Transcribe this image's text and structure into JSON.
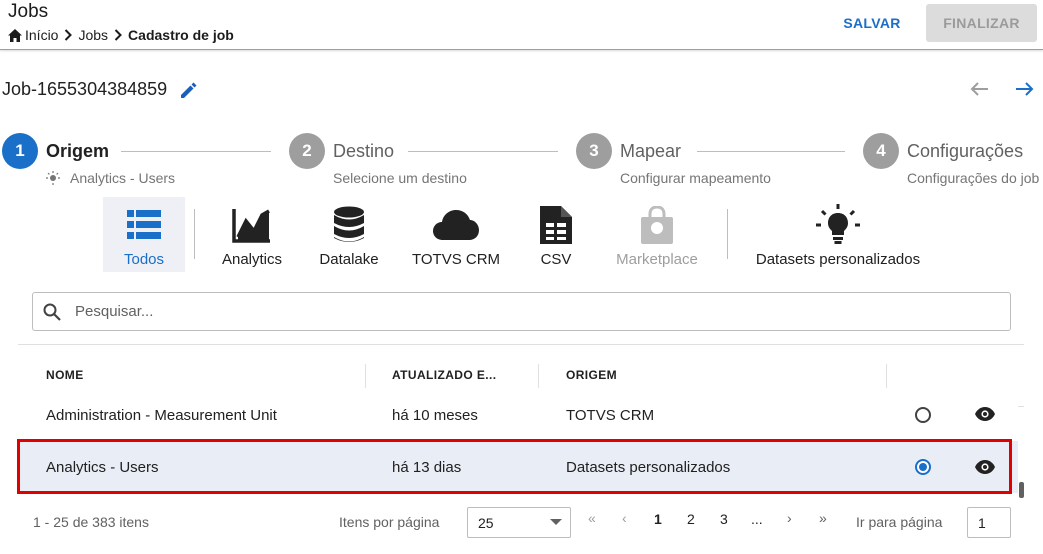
{
  "header": {
    "title": "Jobs",
    "breadcrumb": [
      "Início",
      "Jobs",
      "Cadastro de job"
    ],
    "save_label": "SALVAR",
    "finish_label": "FINALIZAR"
  },
  "job": {
    "name": "Job-1655304384859"
  },
  "stepper": {
    "steps": [
      {
        "number": "1",
        "label": "Origem",
        "subtitle": "Analytics - Users",
        "state": "active"
      },
      {
        "number": "2",
        "label": "Destino",
        "subtitle": "Selecione um destino",
        "state": "inactive"
      },
      {
        "number": "3",
        "label": "Mapear",
        "subtitle": "Configurar mapeamento",
        "state": "inactive"
      },
      {
        "number": "4",
        "label": "Configurações",
        "subtitle": "Configurações do job",
        "state": "inactive"
      }
    ]
  },
  "categories": [
    {
      "label": "Todos",
      "icon": "list-icon",
      "state": "selected"
    },
    {
      "label": "Analytics",
      "icon": "chart-line-icon",
      "state": "normal"
    },
    {
      "label": "Datalake",
      "icon": "database-icon",
      "state": "normal"
    },
    {
      "label": "TOTVS CRM",
      "icon": "cloud-icon",
      "state": "normal"
    },
    {
      "label": "CSV",
      "icon": "csv-file-icon",
      "state": "normal"
    },
    {
      "label": "Marketplace",
      "icon": "shopping-bag-icon",
      "state": "disabled"
    },
    {
      "label": "Datasets personalizados",
      "icon": "lightbulb-icon",
      "state": "normal"
    }
  ],
  "search": {
    "placeholder": "Pesquisar...",
    "value": ""
  },
  "table": {
    "columns": [
      "NOME",
      "ATUALIZADO E...",
      "ORIGEM"
    ],
    "rows": [
      {
        "name": "Administration - Measurement Unit",
        "updated": "há 10 meses",
        "origin": "TOTVS CRM",
        "selected": false
      },
      {
        "name": "Analytics - Users",
        "updated": "há 13 dias",
        "origin": "Datasets personalizados",
        "selected": true
      }
    ]
  },
  "pagination": {
    "range_text": "1 - 25 de 383 itens",
    "items_per_page_label": "Itens por página",
    "items_per_page": "25",
    "first": "«",
    "prev": "‹",
    "pages": [
      "1",
      "2",
      "3"
    ],
    "current_page": "1",
    "ellipsis": "...",
    "next": "›",
    "last": "»",
    "goto_label": "Ir para página",
    "goto_value": "1"
  },
  "colors": {
    "primary": "#1a6fc9",
    "step_inactive": "#9e9e9e",
    "selected_row_bg": "#e9edf5",
    "highlight_border": "#e00000"
  }
}
